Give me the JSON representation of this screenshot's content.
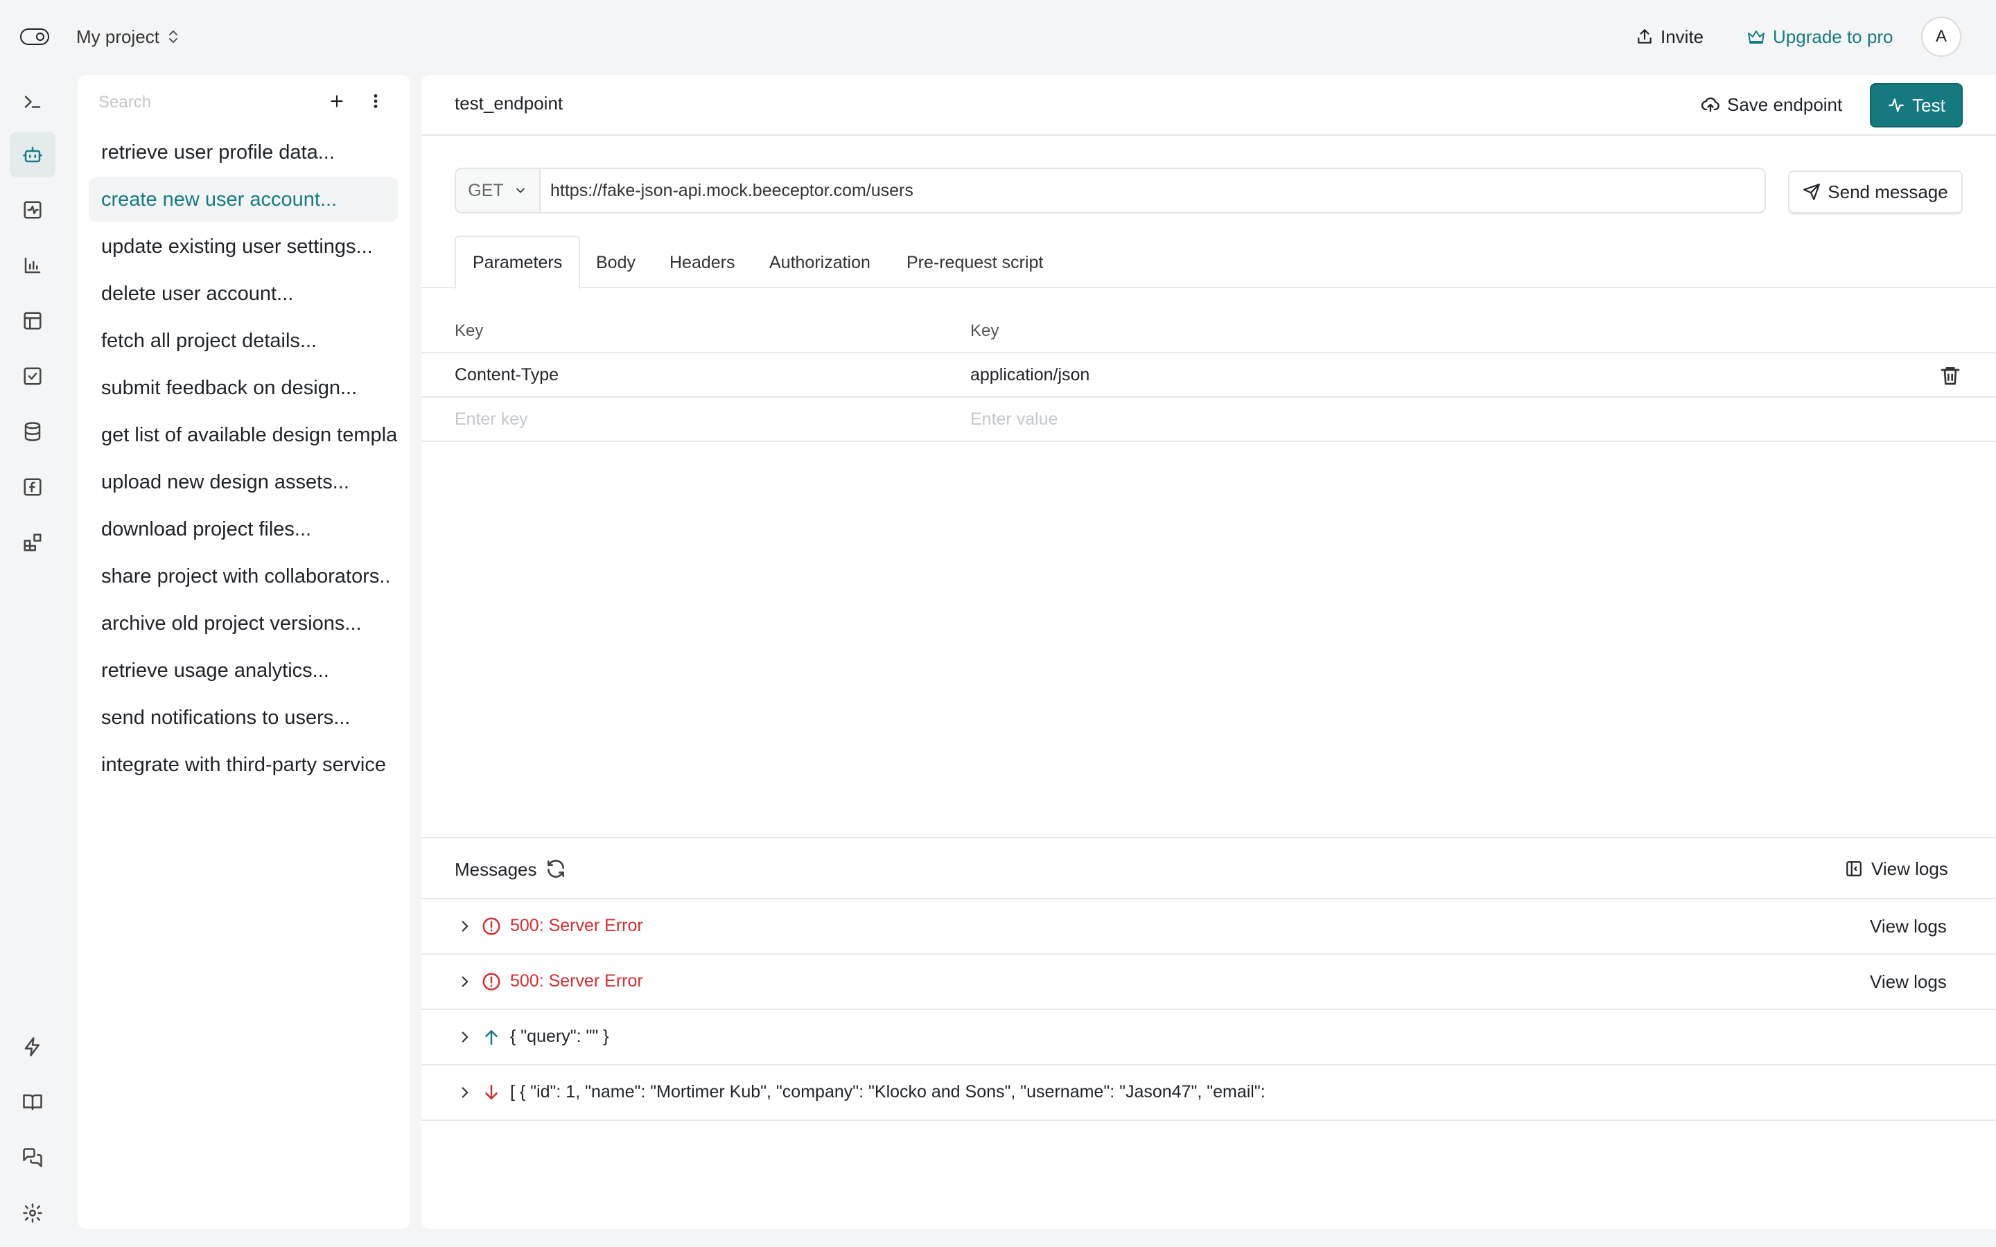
{
  "topbar": {
    "project_name": "My project",
    "invite_label": "Invite",
    "upgrade_label": "Upgrade to pro",
    "avatar_initial": "A",
    "accent_color": "#167b82"
  },
  "rail": {
    "top_icons": [
      "terminal-icon",
      "bot-icon",
      "activity-icon",
      "bar-chart-icon",
      "table-icon",
      "checkbox-icon",
      "database-icon",
      "function-icon",
      "blocks-icon"
    ],
    "bottom_icons": [
      "zap-icon",
      "book-icon",
      "chat-icon",
      "settings-icon"
    ],
    "active_icon": "bot-icon"
  },
  "list": {
    "search_placeholder": "Search",
    "items": [
      "retrieve user profile data...",
      "create new user account...",
      "update existing user settings...",
      "delete user account...",
      "fetch all project details...",
      "submit feedback on design...",
      "get list of available design templa",
      "upload new design assets...",
      "download project files...",
      "share project with collaborators..",
      "archive old project versions...",
      "retrieve usage analytics...",
      "send notifications to users...",
      "integrate with third-party service"
    ],
    "active_index": 1
  },
  "endpoint": {
    "name": "test_endpoint",
    "save_label": "Save endpoint",
    "test_label": "Test",
    "method": "GET",
    "url": "https://fake-json-api.mock.beeceptor.com/users",
    "send_label": "Send message"
  },
  "tabs": [
    "Parameters",
    "Body",
    "Headers",
    "Authorization",
    "Pre-request script"
  ],
  "params": {
    "key_header": "Key",
    "value_header": "Key",
    "rows": [
      {
        "key": "Content-Type",
        "value": "application/json"
      }
    ],
    "key_placeholder": "Enter key",
    "value_placeholder": "Enter value"
  },
  "messages": {
    "title": "Messages",
    "view_logs_label": "View logs",
    "rows": [
      {
        "type": "error",
        "text": "500: Server Error",
        "logs": "View logs"
      },
      {
        "type": "error",
        "text": "500: Server Error",
        "logs": "View logs"
      },
      {
        "type": "outgoing",
        "text": "{ \"query\": \"\" }",
        "logs": ""
      },
      {
        "type": "incoming",
        "text": "[ { \"id\": 1, \"name\": \"Mortimer Kub\", \"company\": \"Klocko and Sons\", \"username\": \"Jason47\", \"email\":",
        "logs": ""
      }
    ],
    "error_color": "#d0302f",
    "outgoing_color": "#167b82"
  }
}
